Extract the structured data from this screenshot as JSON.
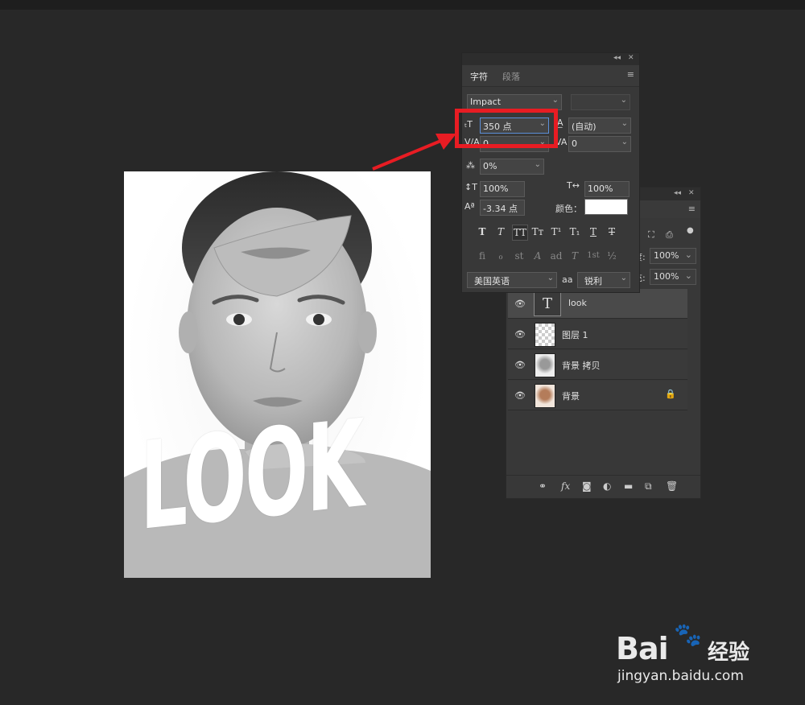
{
  "canvas": {
    "overlay_text": "LOOK"
  },
  "character_panel": {
    "tabs": [
      "字符",
      "段落"
    ],
    "active_tab": "字符",
    "font_family": "Impact",
    "font_style": "",
    "font_size": "350 点",
    "leading": "(自动)",
    "kerning": "0",
    "tracking": "0",
    "tsume": "0%",
    "vertical_scale": "100%",
    "horizontal_scale": "100%",
    "baseline_shift": "-3.34 点",
    "color_label": "颜色：",
    "color_value": "#ffffff",
    "language": "美国英语",
    "antialias_icon": "aa",
    "antialias": "锐利",
    "style_buttons": [
      "T",
      "T",
      "TT",
      "Tт",
      "T¹",
      "T₁",
      "T",
      "T"
    ],
    "glyph_buttons": [
      "fi",
      "ℴ",
      "st",
      "A",
      "ad",
      "T",
      "1st",
      "½"
    ]
  },
  "layers_panel": {
    "opacity_label": "度:",
    "opacity": "100%",
    "fill_label": "充:",
    "fill": "100%",
    "layers": [
      {
        "name": "look",
        "type": "text",
        "thumb": "T",
        "visible": true,
        "active": true
      },
      {
        "name": "图层 1",
        "type": "empty",
        "visible": true,
        "active": false
      },
      {
        "name": "背景 拷贝",
        "type": "image",
        "visible": true,
        "active": false
      },
      {
        "name": "背景",
        "type": "image-color",
        "visible": true,
        "active": false,
        "locked": true
      }
    ],
    "footer_icons": [
      "link-icon",
      "fx-icon",
      "mask-icon",
      "adjustment-icon",
      "folder-icon",
      "new-layer-icon",
      "trash-icon"
    ],
    "footer_fx": "fx"
  },
  "watermark": {
    "brand": "Bai",
    "brand2": "经验",
    "url": "jingyan.baidu.com"
  },
  "colors": {
    "highlight": "#e81c23",
    "panel_bg": "#383838",
    "app_bg": "#282828"
  }
}
